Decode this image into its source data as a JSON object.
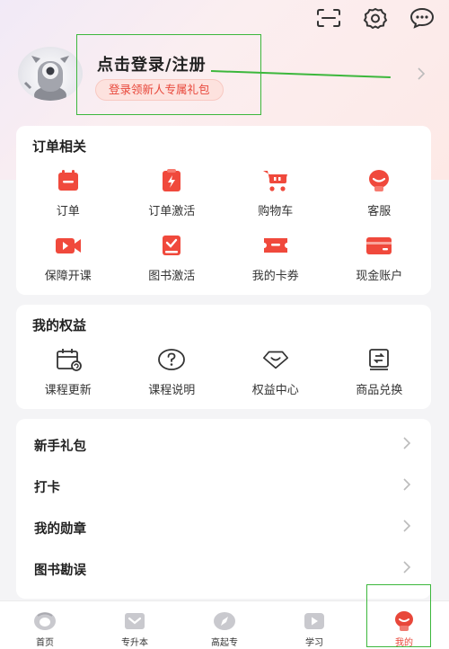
{
  "header": {
    "icons": [
      "scan-icon",
      "settings-icon",
      "message-icon"
    ]
  },
  "profile": {
    "login_text": "点击登录/注册",
    "promo_badge": "登录领新人专属礼包"
  },
  "orders": {
    "title": "订单相关",
    "items": [
      {
        "label": "订单",
        "icon": "order-icon"
      },
      {
        "label": "订单激活",
        "icon": "order-activate-icon"
      },
      {
        "label": "购物车",
        "icon": "cart-icon"
      },
      {
        "label": "客服",
        "icon": "customer-service-icon"
      },
      {
        "label": "保障开课",
        "icon": "video-course-icon"
      },
      {
        "label": "图书激活",
        "icon": "book-activate-icon"
      },
      {
        "label": "我的卡券",
        "icon": "coupon-icon"
      },
      {
        "label": "现金账户",
        "icon": "card-icon"
      }
    ]
  },
  "benefits": {
    "title": "我的权益",
    "items": [
      {
        "label": "课程更新",
        "icon": "calendar-refresh-icon"
      },
      {
        "label": "课程说明",
        "icon": "question-icon"
      },
      {
        "label": "权益中心",
        "icon": "heart-diamond-icon"
      },
      {
        "label": "商品兑换",
        "icon": "exchange-icon"
      }
    ]
  },
  "list": {
    "items": [
      "新手礼包",
      "打卡",
      "我的勋章",
      "图书勘误"
    ]
  },
  "tabbar": {
    "tabs": [
      {
        "label": "首页",
        "icon": "home-icon"
      },
      {
        "label": "专升本",
        "icon": "mail-icon"
      },
      {
        "label": "高起专",
        "icon": "compass-icon"
      },
      {
        "label": "学习",
        "icon": "play-icon"
      },
      {
        "label": "我的",
        "icon": "profile-icon",
        "active": true
      }
    ]
  },
  "colors": {
    "accent": "#e8473a",
    "highlight": "#3cb73c"
  }
}
